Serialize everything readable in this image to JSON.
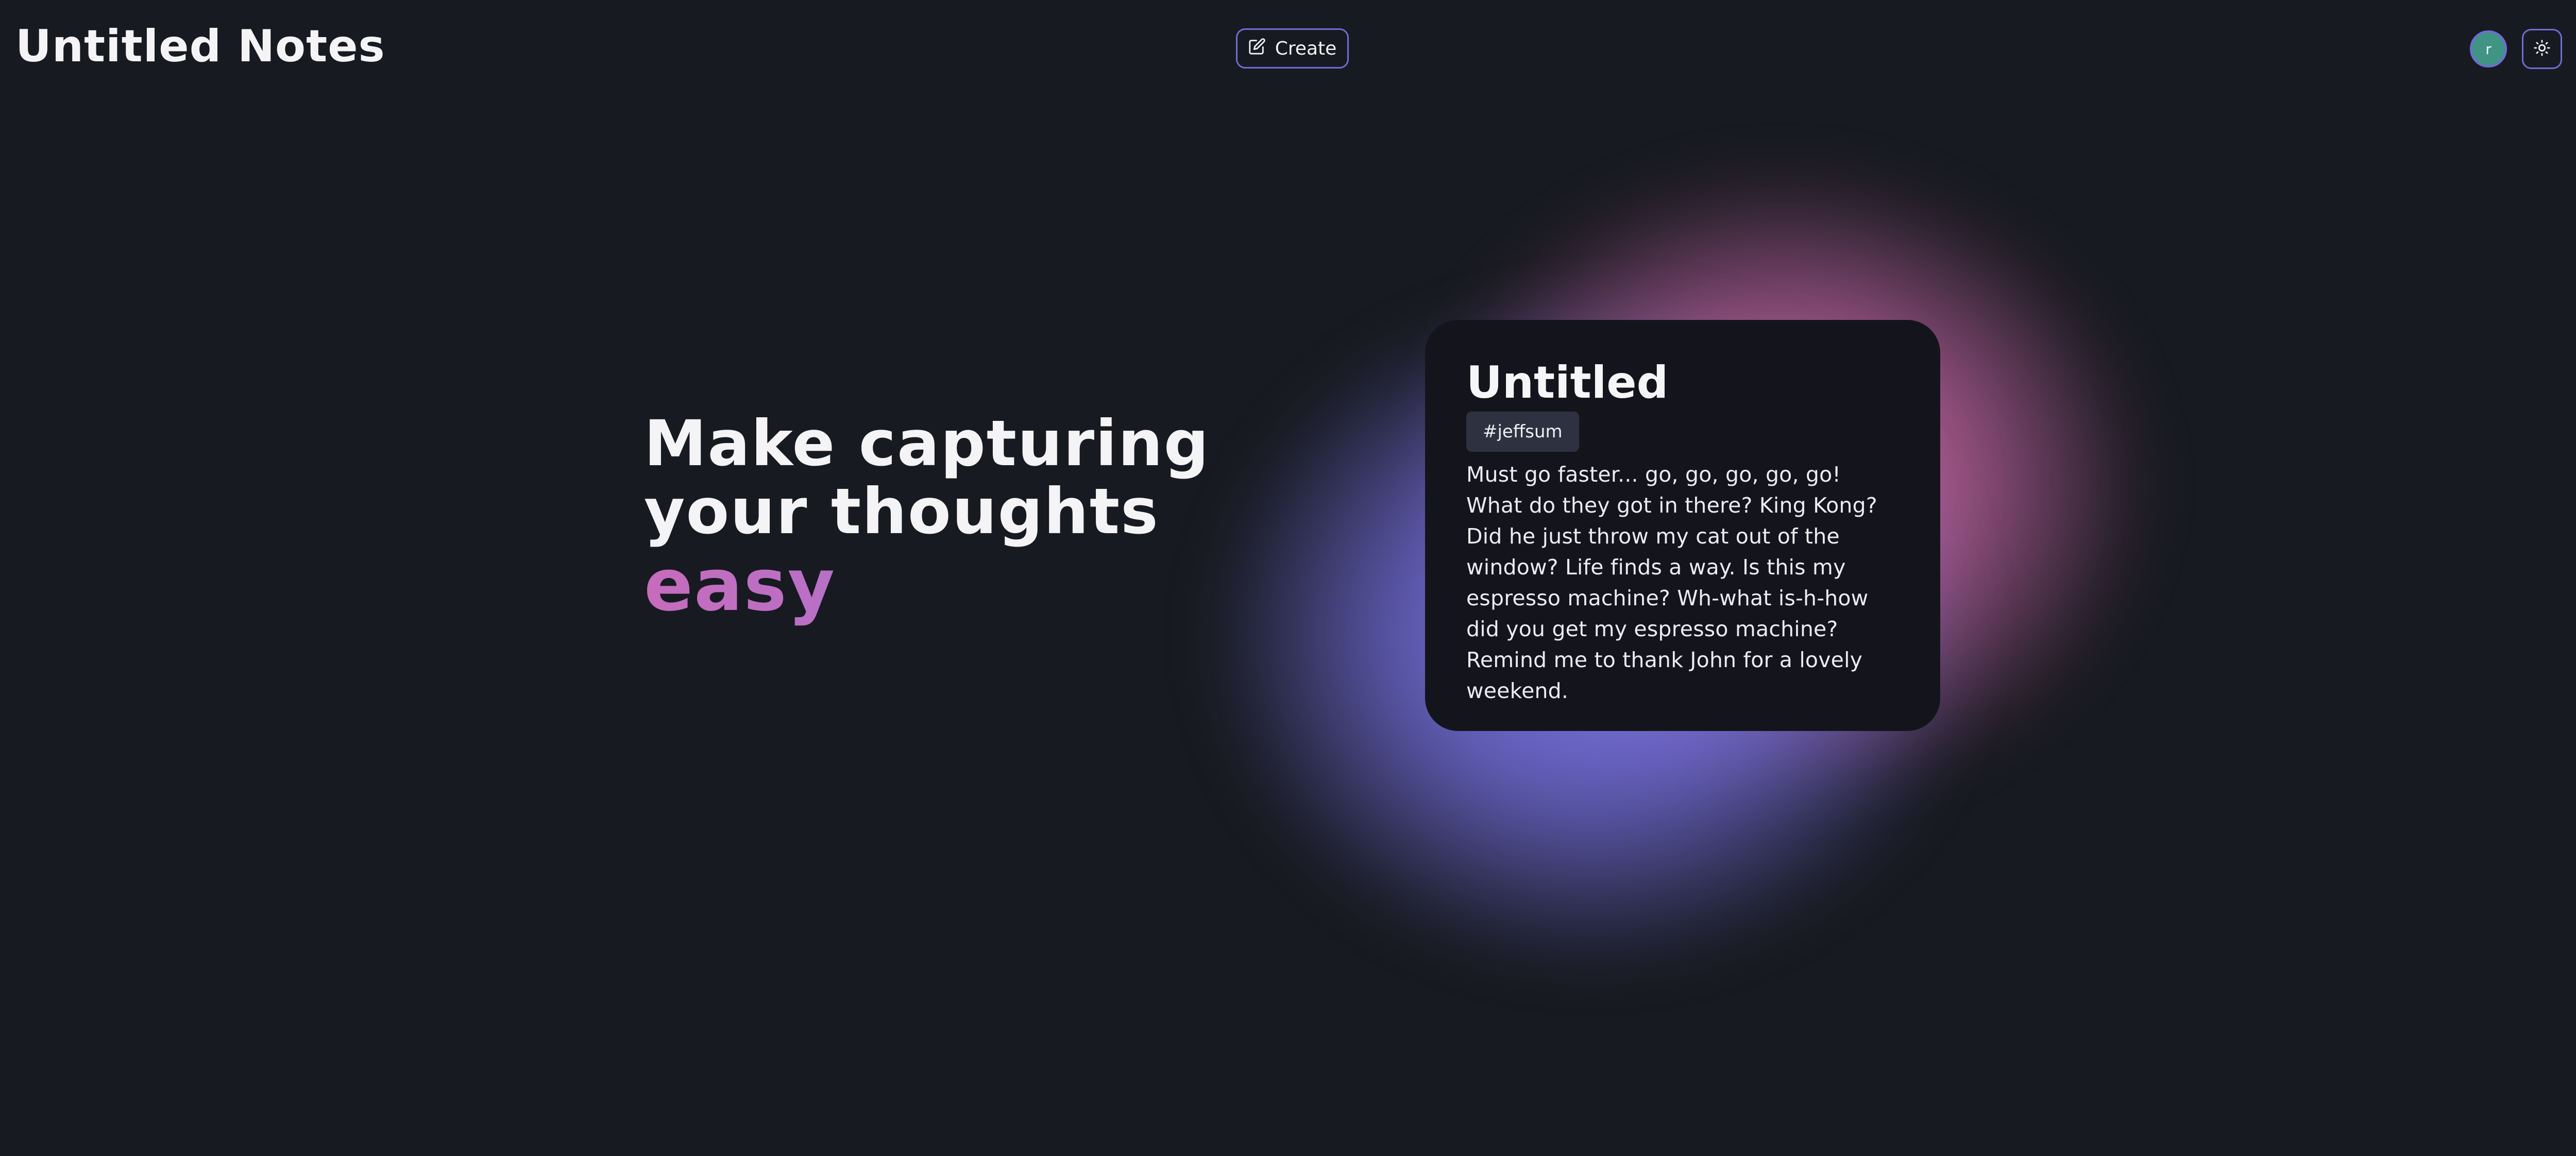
{
  "header": {
    "brand": "Untitled Notes",
    "create_label": "Create",
    "avatar_initial": "r"
  },
  "hero": {
    "line1": "Make capturing",
    "line2": "your thoughts",
    "accent": "easy"
  },
  "note": {
    "title": "Untitled",
    "tag": "#jeffsum",
    "body": "Must go faster... go, go, go, go, go! What do they got in there? King Kong? Did he just throw my cat out of the window? Life finds a way. Is this my espresso machine? Wh-what is-h-how did you get my espresso machine? Remind me to thank John for a lovely weekend."
  },
  "icons": {
    "create": "edit-icon",
    "theme": "sun-icon"
  },
  "colors": {
    "background": "#181a21",
    "accent_border": "#6f6cd8",
    "avatar": "#3f9483",
    "gradient_start": "#c66cbc",
    "gradient_end": "#9b78d8",
    "glow_pink": "#dc73af",
    "glow_blue": "#7d78e6",
    "card": "#14151c",
    "tag_bg": "#2d3140"
  }
}
